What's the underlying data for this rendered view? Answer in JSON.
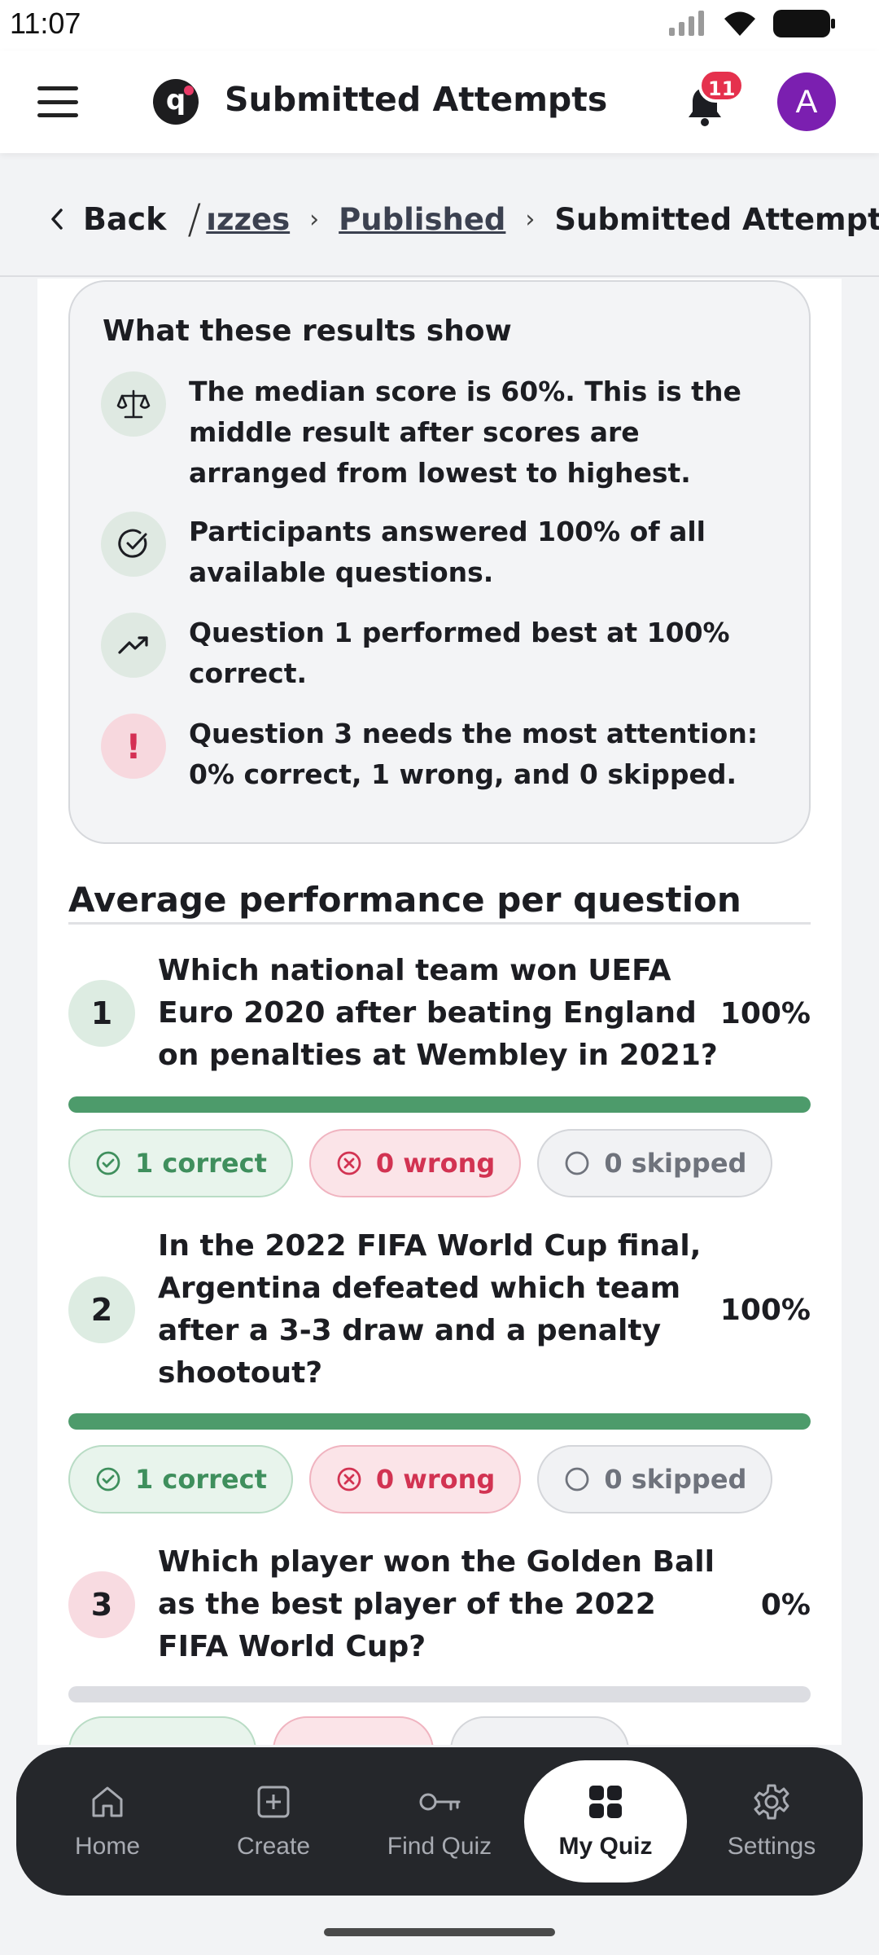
{
  "status_bar": {
    "time": "11:07"
  },
  "header": {
    "title": "Submitted Attempts",
    "logo_letter": "q",
    "notification_count": "11",
    "avatar_initial": "A"
  },
  "breadcrumb": {
    "back": "Back",
    "items": [
      "ızzes",
      "Published"
    ],
    "current": "Submitted Attempts"
  },
  "summary": {
    "heading": "What these results show",
    "items": [
      {
        "icon": "scale-icon",
        "text": "The median score is 60%. This is the middle result after scores are arranged from lowest to highest."
      },
      {
        "icon": "check-circle-icon",
        "text": "Participants answered 100% of all available questions."
      },
      {
        "icon": "trending-up-icon",
        "text": "Question 1 performed best at 100% correct."
      },
      {
        "icon": "exclamation-icon",
        "text": "Question 3 needs the most attention: 0% correct, 1 wrong, and 0 skipped."
      }
    ]
  },
  "performance": {
    "title": "Average performance per question",
    "questions": [
      {
        "number": "1",
        "text": "Which national team won UEFA Euro 2020 after beating England on penalties at Wembley in 2021?",
        "percent": "100%",
        "fill": 1.0,
        "correct": "1 correct",
        "wrong": "0 wrong",
        "skipped": "0 skipped"
      },
      {
        "number": "2",
        "text": "In the 2022 FIFA World Cup final, Argentina defeated which team after a 3-3 draw and a penalty shootout?",
        "percent": "100%",
        "fill": 1.0,
        "correct": "1 correct",
        "wrong": "0 wrong",
        "skipped": "0 skipped"
      },
      {
        "number": "3",
        "text": "Which player won the Golden Ball as the best player of the 2022 FIFA World Cup?",
        "percent": "0%",
        "fill": 0.0
      }
    ]
  },
  "bottom_nav": {
    "items": [
      {
        "label": "Home",
        "icon": "home-icon"
      },
      {
        "label": "Create",
        "icon": "plus-square-icon"
      },
      {
        "label": "Find Quiz",
        "icon": "key-icon"
      },
      {
        "label": "My Quiz",
        "icon": "grid-icon",
        "active": true
      },
      {
        "label": "Settings",
        "icon": "gear-icon"
      }
    ]
  },
  "colors": {
    "accent_green": "#4d9b6b",
    "wrong_red": "#d23352",
    "avatar_purple": "#7b1fb0",
    "nav_bg": "#25272b"
  }
}
